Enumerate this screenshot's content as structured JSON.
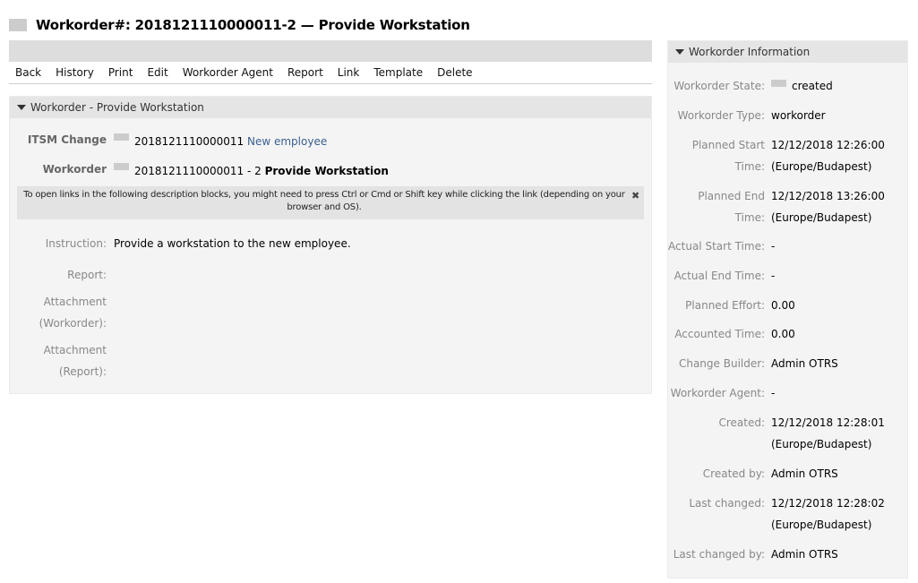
{
  "page": {
    "title": "Workorder#: 2018121110000011-2 — Provide Workstation"
  },
  "actions": [
    "Back",
    "History",
    "Print",
    "Edit",
    "Workorder Agent",
    "Report",
    "Link",
    "Template",
    "Delete"
  ],
  "workorder_widget": {
    "header": "Workorder - Provide Workstation",
    "itsm_change_label": "ITSM Change",
    "change_number": "2018121110000011",
    "change_title": "New employee",
    "workorder_label": "Workorder",
    "workorder_number": "2018121110000011 - 2",
    "workorder_title": "Provide Workstation",
    "notice": "To open links in the following description blocks, you might need to press Ctrl or Cmd or Shift key while clicking the link (depending on your browser and OS).",
    "instruction_label": "Instruction:",
    "instruction_value": "Provide a workstation to the new employee.",
    "report_label": "Report:",
    "attachment_workorder_label_1": "Attachment",
    "attachment_workorder_label_2": "(Workorder):",
    "attachment_report_label_1": "Attachment",
    "attachment_report_label_2": "(Report):"
  },
  "sidebar": {
    "header": "Workorder Information",
    "state_label": "Workorder State:",
    "state_value": "created",
    "type_label": "Workorder Type:",
    "type_value": "workorder",
    "planned_start_label_1": "Planned Start",
    "planned_start_label_2": "Time:",
    "planned_start_value_1": "12/12/2018 12:26:00",
    "planned_start_value_2": "(Europe/Budapest)",
    "planned_end_label_1": "Planned End",
    "planned_end_label_2": "Time:",
    "planned_end_value_1": "12/12/2018 13:26:00",
    "planned_end_value_2": "(Europe/Budapest)",
    "actual_start_label": "Actual Start Time:",
    "actual_start_value": "-",
    "actual_end_label": "Actual End Time:",
    "actual_end_value": "-",
    "planned_effort_label": "Planned Effort:",
    "planned_effort_value": "0.00",
    "accounted_time_label": "Accounted Time:",
    "accounted_time_value": "0.00",
    "change_builder_label": "Change Builder:",
    "change_builder_value": "Admin OTRS",
    "workorder_agent_label": "Workorder Agent:",
    "workorder_agent_value": "-",
    "created_label": "Created:",
    "created_value_1": "12/12/2018 12:28:01",
    "created_value_2": "(Europe/Budapest)",
    "created_by_label": "Created by:",
    "created_by_value": "Admin OTRS",
    "last_changed_label": "Last changed:",
    "last_changed_value_1": "12/12/2018 12:28:02",
    "last_changed_value_2": "(Europe/Budapest)",
    "last_changed_by_label": "Last changed by:",
    "last_changed_by_value": "Admin OTRS"
  },
  "icons": {
    "collapse": "triangle-down-icon",
    "close": "close-icon"
  },
  "colors": {
    "link": "#3a5f8f",
    "panel_bg": "#f4f4f4",
    "header_bg": "#e5e5e5"
  }
}
